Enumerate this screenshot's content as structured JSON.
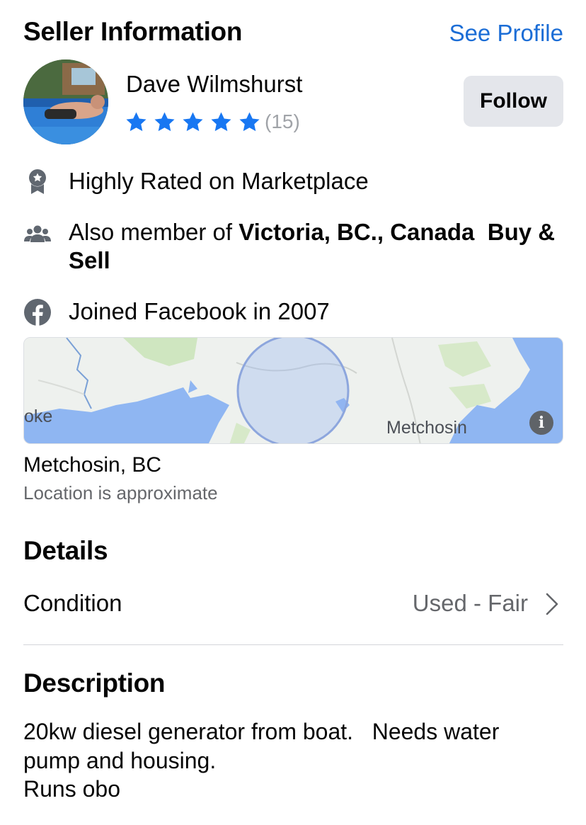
{
  "seller_section": {
    "title": "Seller Information",
    "see_profile": "See Profile",
    "seller_name": "Dave Wilmshurst",
    "rating_stars": 5,
    "rating_count": "(15)",
    "follow_label": "Follow"
  },
  "badges": {
    "highly_rated": "Highly Rated on Marketplace",
    "member_prefix": "Also member of ",
    "member_group": "Victoria, BC., Canada  Buy &",
    "member_group_line2": "Sell",
    "joined": "Joined Facebook in 2007"
  },
  "map": {
    "label_left": "oke",
    "label_right": "Metchosin",
    "info_glyph": "i"
  },
  "location": {
    "name": "Metchosin, BC",
    "note": "Location is approximate"
  },
  "details": {
    "title": "Details",
    "condition_label": "Condition",
    "condition_value": "Used - Fair"
  },
  "description": {
    "title": "Description",
    "lines": [
      "20kw diesel generator from boat.   Needs water",
      "pump and housing.",
      "Runs obo"
    ]
  },
  "colors": {
    "link_blue": "#1b6dd6",
    "star_blue": "#1877f2",
    "button_gray": "#e4e6eb",
    "water_blue": "#8fb6f2",
    "land_green": "#cfe6c0"
  },
  "icons": [
    "award-ribbon-icon",
    "group-icon",
    "facebook-icon",
    "star-icon",
    "chevron-right-icon",
    "info-icon"
  ]
}
